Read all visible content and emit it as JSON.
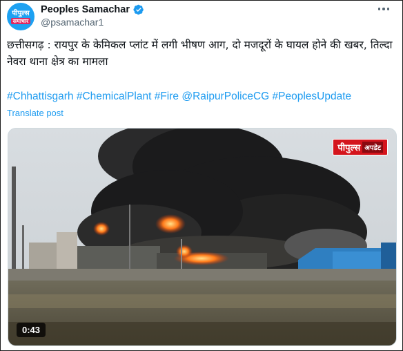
{
  "author": {
    "display_name": "Peoples Samachar",
    "handle": "@psamachar1",
    "avatar_text_line1": "पीपुल्स",
    "avatar_text_line2": "समाचार",
    "verified": true,
    "verified_color": "#1d9bf0"
  },
  "tweet": {
    "text": "छत्तीसगढ़ : रायपुर के केमिकल प्लांट में लगी भीषण आग, दो मजदूरों के घायल होने की खबर, तिल्दा नेवरा थाना क्षेत्र का मामला",
    "hashtags": [
      "#Chhattisgarh",
      "#ChemicalPlant",
      "#Fire",
      "@RaipurPoliceCG",
      "#PeoplesUpdate"
    ],
    "translate_label": "Translate post"
  },
  "media": {
    "type": "video",
    "badge_main": "पीपुल्स",
    "badge_sub": "अपडेट",
    "duration": "0:43",
    "badge_color": "#d4141c"
  },
  "colors": {
    "link": "#1d9bf0",
    "text": "#0f1419",
    "secondary": "#536471"
  },
  "icons": {
    "verified": "verified-badge-icon",
    "more": "more-options-icon"
  }
}
